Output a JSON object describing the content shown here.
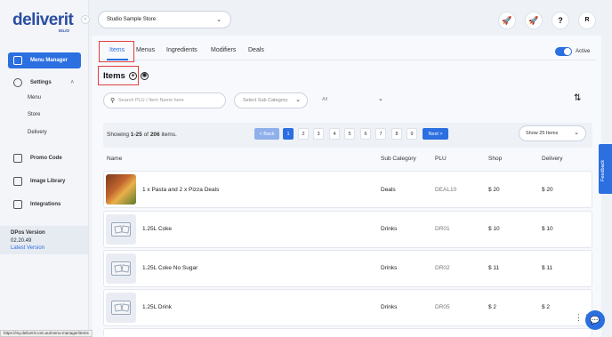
{
  "brand": {
    "name": "deliverit",
    "sub": "IDLIO"
  },
  "sidebar": {
    "collapse_glyph": "‹",
    "items": [
      {
        "label": "Menu Manager",
        "icon": "menu-icon",
        "active": true
      },
      {
        "label": "Settings",
        "icon": "gear-icon",
        "active": false
      },
      {
        "label": "Promo Code",
        "icon": "promo-icon",
        "active": false
      },
      {
        "label": "Image Library",
        "icon": "image-icon",
        "active": false
      },
      {
        "label": "Integrations",
        "icon": "integrations-icon",
        "active": false
      }
    ],
    "settings_sub": [
      "Menu",
      "Store",
      "Delivery"
    ],
    "version": {
      "title": "DPos Version",
      "number": "02.20.49",
      "link": "Latest Version"
    }
  },
  "topbar": {
    "store": "Studio Sample Store",
    "icons": [
      {
        "name": "rocket-icon",
        "glyph": "🚀"
      },
      {
        "name": "rocket-outline-icon",
        "glyph": "🚀"
      },
      {
        "name": "help-icon",
        "glyph": "?"
      },
      {
        "name": "avatar",
        "glyph": "R"
      }
    ]
  },
  "tabs": [
    "Items",
    "Menus",
    "Ingredients",
    "Modifiers",
    "Deals"
  ],
  "active_tab": "Items",
  "toggle": {
    "label": "Active",
    "on": true
  },
  "section": {
    "title": "Items",
    "add_glyph": "+",
    "scan_glyph": "◉"
  },
  "filters": {
    "search_placeholder": "Search PLU / Item Name here",
    "subcategory_placeholder": "Select Sub Category",
    "type_value": "All"
  },
  "pagination": {
    "showing_prefix": "Showing ",
    "range": "1-25",
    "of": " of ",
    "total": "206",
    "suffix": " items.",
    "back": "< Back",
    "pages": [
      "1",
      "2",
      "3",
      "4",
      "5",
      "6",
      "7",
      "8",
      "9"
    ],
    "current": "1",
    "next": "Next >",
    "per_page": "Show 25 Items"
  },
  "table": {
    "columns": [
      "Name",
      "Sub Category",
      "PLU",
      "Shop",
      "Delivery"
    ],
    "rows": [
      {
        "name": "1 x Pasta and 2 x Pizza Deals",
        "subcategory": "Deals",
        "plu": "DEAL10",
        "shop": "$ 20",
        "delivery": "$ 20",
        "has_photo": true
      },
      {
        "name": "1.25L Coke",
        "subcategory": "Drinks",
        "plu": "DR01",
        "shop": "$ 10",
        "delivery": "$ 10",
        "has_photo": false
      },
      {
        "name": "1.25L Coke No Sugar",
        "subcategory": "Drinks",
        "plu": "DR02",
        "shop": "$ 11",
        "delivery": "$ 11",
        "has_photo": false
      },
      {
        "name": "1.25L Drink",
        "subcategory": "Drinks",
        "plu": "DR05",
        "shop": "$ 2",
        "delivery": "$ 2",
        "has_photo": false
      }
    ]
  },
  "feedback_label": "Feedback",
  "status_url": "https://my.deliverit.com.au/menu-manager/items",
  "colors": {
    "primary": "#2b6fe0",
    "highlight": "#e04040",
    "brand": "#2b4ea2"
  }
}
